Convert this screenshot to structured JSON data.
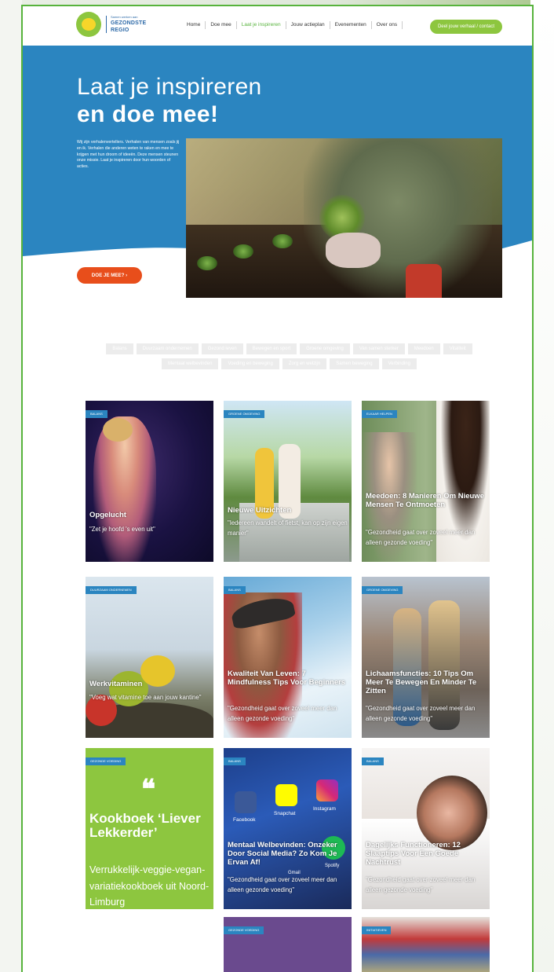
{
  "header": {
    "logo": {
      "tagline": "Samen werken aan",
      "line1": "GEZONDSTE",
      "line2": "REGIO"
    },
    "nav": [
      "Home",
      "Doe mee",
      "Laat je inspireren",
      "Jouw actieplan",
      "Evenementen",
      "Over ons"
    ],
    "active_nav": "Laat je inspireren",
    "cta_label": "Deel jouw verhaal / contact"
  },
  "hero": {
    "title_line1": "Laat je inspireren",
    "title_line2": "en doe mee!",
    "intro": "Wij zijn verhalenvertellers. Verhalen van mensen zoals jij en ik. Verhalen die anderen weten te raken en mee te krijgen met hun droom of ideeën. Deze mensen steunen onze missie. Laat je inspireren door hun woorden of acties.",
    "button_label": "DOE JE MEE? ›"
  },
  "filters": [
    "Balans",
    "Duurzaam ondernemen",
    "Gezond leven",
    "Bewegen en sport",
    "Groene omgeving",
    "Van samen sterker",
    "Meedoen",
    "Vitaliteit",
    "Mentaal welbevinden",
    "Voeding en beweging",
    "Zorg en welzijn",
    "Samen beweging",
    "Verbinding"
  ],
  "cards": [
    {
      "badge": "BALANS",
      "title": "Opgelucht",
      "quote": "\"Zet je hoofd 's even uit\""
    },
    {
      "badge": "GROENE OMGEVING",
      "title": "Nieuwe Uitzichten",
      "quote": "\"Iedereen wandelt of fietst, kan op zijn eigen manier\""
    },
    {
      "badge": "ELKAAR HELPEN",
      "title": "Meedoen: 8 Manieren Om Nieuwe Mensen Te Ontmoeten",
      "quote": "\"Gezondheid gaat over zoveel meer dan alleen gezonde voeding\""
    },
    {
      "badge": "DUURZAAM ONDERNEMEN",
      "title": "Werkvitaminen",
      "quote": "\"Voeg wat vitamine toe aan jouw kantine\""
    },
    {
      "badge": "BALANS",
      "title": "Kwaliteit Van Leven: 7 Mindfulness Tips Voor Beginners",
      "quote": "\"Gezondheid gaat over zoveel meer dan alleen gezonde voeding\""
    },
    {
      "badge": "GROENE OMGEVING",
      "title": "Lichaamsfuncties: 10 Tips Om Meer Te Bewegen En Minder Te Zitten",
      "quote": "\"Gezondheid gaat over zoveel meer dan alleen gezonde voeding\""
    },
    {
      "badge": "GEZONDE VOEDING",
      "title": "Kookboek ‘Liever Lekkerder’",
      "quote": "Verrukkelijk-veggie-vegan-variatiekookboek uit Noord-Limburg"
    },
    {
      "badge": "BALANS",
      "title": "Mentaal Welbevinden: Onzeker Door Social Media? Zo Kom Je Ervan Af!",
      "quote": "\"Gezondheid gaat over zoveel meer dan alleen gezonde voeding\""
    },
    {
      "badge": "BALANS",
      "title": "Dagelijks Functioneren: 12 Slaaptips Voor Een Goede Nachtrust",
      "quote": "\"Gezondheid gaat over zoveel meer dan alleen gezonde voeding\""
    },
    {
      "badge": "GEZONDE VOEDING",
      "title": "",
      "quote": ""
    },
    {
      "badge": "INITIATIEVEN",
      "title": "",
      "quote": ""
    }
  ],
  "social_labels": {
    "facebook": "Facebook",
    "snapchat": "Snapchat",
    "instagram": "Instagram",
    "spotify": "Spotify",
    "gmail": "Gmail"
  },
  "colors": {
    "brand_blue": "#2b85c0",
    "brand_green": "#8dc63f",
    "accent_orange": "#e84e1b"
  }
}
